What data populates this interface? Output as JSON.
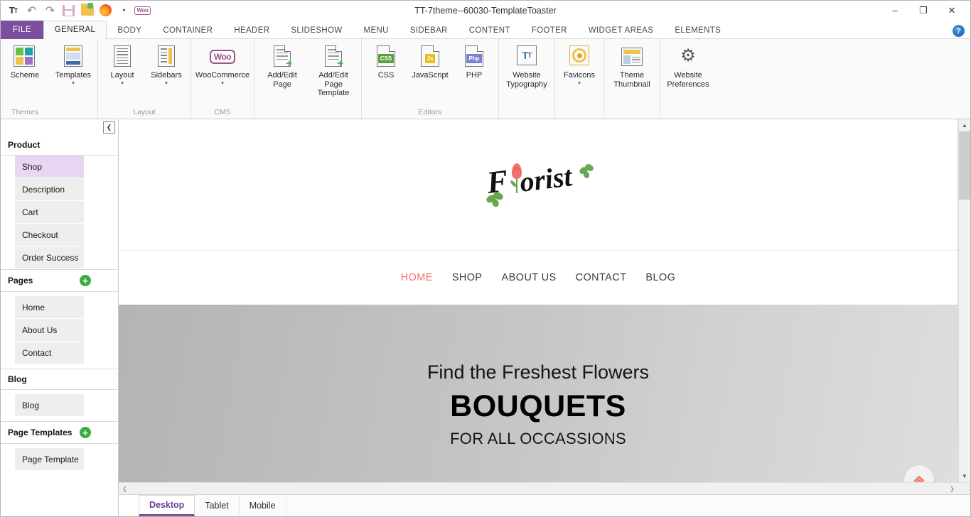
{
  "window": {
    "title": "TT-7theme--60030-TemplateToaster",
    "minimize_label": "—",
    "restore_label": "❐",
    "close_label": "✕",
    "help_label": "?"
  },
  "quick_access": [
    {
      "name": "typography-icon",
      "label": "TT"
    },
    {
      "name": "undo-icon",
      "label": "↶"
    },
    {
      "name": "redo-icon",
      "label": "↷"
    },
    {
      "name": "save-icon",
      "label": "Save"
    },
    {
      "name": "publish-icon",
      "label": "Publish"
    },
    {
      "name": "firefox-preview-icon",
      "label": "Preview"
    },
    {
      "name": "preview-dropdown-icon",
      "label": "▾"
    },
    {
      "name": "woocommerce-icon",
      "label": "Woo"
    }
  ],
  "ribbon": {
    "file_tab": "FILE",
    "tabs": [
      {
        "label": "GENERAL",
        "active": true
      },
      {
        "label": "BODY",
        "active": false
      },
      {
        "label": "CONTAINER",
        "active": false
      },
      {
        "label": "HEADER",
        "active": false
      },
      {
        "label": "SLIDESHOW",
        "active": false
      },
      {
        "label": "MENU",
        "active": false
      },
      {
        "label": "SIDEBAR",
        "active": false
      },
      {
        "label": "CONTENT",
        "active": false
      },
      {
        "label": "FOOTER",
        "active": false
      },
      {
        "label": "WIDGET AREAS",
        "active": false
      },
      {
        "label": "ELEMENTS",
        "active": false
      }
    ],
    "groups": [
      {
        "name": "themes",
        "label": "Themes",
        "buttons": [
          {
            "name": "scheme",
            "label": "Scheme",
            "icon": "scheme-icon",
            "caret": false
          }
        ]
      },
      {
        "name": "themes-templates",
        "label": "",
        "buttons": [
          {
            "name": "templates",
            "label": "Templates",
            "icon": "templates-icon",
            "caret": true
          }
        ]
      },
      {
        "name": "layout",
        "label": "Layout",
        "buttons": [
          {
            "name": "layout",
            "label": "Layout",
            "icon": "layout-icon",
            "caret": true
          },
          {
            "name": "sidebars",
            "label": "Sidebars",
            "icon": "sidebars-icon",
            "caret": true
          }
        ]
      },
      {
        "name": "cms",
        "label": "CMS",
        "buttons": [
          {
            "name": "woocommerce",
            "label": "WooCommerce",
            "icon": "woocommerce-icon",
            "caret": true
          }
        ]
      },
      {
        "name": "pages",
        "label": "",
        "buttons": [
          {
            "name": "add-edit-page",
            "label": "Add/Edit Page",
            "icon": "page-add-icon",
            "caret": false
          },
          {
            "name": "add-edit-page-template",
            "label": "Add/Edit Page Template",
            "icon": "page-template-add-icon",
            "caret": false
          }
        ]
      },
      {
        "name": "editors",
        "label": "Editors",
        "buttons": [
          {
            "name": "css-editor",
            "label": "CSS",
            "icon": "css-file-icon",
            "badge": "CSS",
            "badge_color": "#5a9e3f",
            "caret": false
          },
          {
            "name": "javascript-editor",
            "label": "JavaScript",
            "icon": "js-file-icon",
            "badge": "Js",
            "badge_color": "#e3c01a",
            "caret": false
          },
          {
            "name": "php-editor",
            "label": "PHP",
            "icon": "php-file-icon",
            "badge": "Php",
            "badge_color": "#7b7fd4",
            "caret": false
          }
        ]
      },
      {
        "name": "website-settings",
        "label": "",
        "buttons": [
          {
            "name": "website-typography",
            "label": "Website Typography",
            "icon": "typography-icon",
            "caret": false
          },
          {
            "name": "favicons",
            "label": "Favicons",
            "icon": "favicon-icon",
            "caret": true
          },
          {
            "name": "theme-thumbnail",
            "label": "Theme Thumbnail",
            "icon": "thumbnail-icon",
            "caret": false
          },
          {
            "name": "website-preferences",
            "label": "Website Preferences",
            "icon": "gear-icon",
            "caret": false
          }
        ]
      }
    ]
  },
  "sidebar": {
    "collapse_label": "❮",
    "sections": [
      {
        "name": "product",
        "title": "Product",
        "has_add": false,
        "items": [
          {
            "label": "Shop",
            "active": true
          },
          {
            "label": "Description",
            "active": false
          },
          {
            "label": "Cart",
            "active": false
          },
          {
            "label": "Checkout",
            "active": false
          },
          {
            "label": "Order Success",
            "active": false
          }
        ]
      },
      {
        "name": "pages",
        "title": "Pages",
        "has_add": true,
        "add_label": "+",
        "items": [
          {
            "label": "Home",
            "active": false
          },
          {
            "label": "About Us",
            "active": false
          },
          {
            "label": "Contact",
            "active": false
          }
        ]
      },
      {
        "name": "blog",
        "title": "Blog",
        "has_add": false,
        "items": [
          {
            "label": "Blog",
            "active": false
          }
        ]
      },
      {
        "name": "page-templates",
        "title": "Page Templates",
        "has_add": true,
        "add_label": "+",
        "items": [
          {
            "label": "Page Template",
            "active": false
          }
        ]
      }
    ]
  },
  "preview": {
    "logo_text": "Florist",
    "nav": [
      {
        "label": "HOME",
        "active": true
      },
      {
        "label": "SHOP",
        "active": false
      },
      {
        "label": "ABOUT US",
        "active": false
      },
      {
        "label": "CONTACT",
        "active": false
      },
      {
        "label": "BLOG",
        "active": false
      }
    ],
    "hero": {
      "line1": "Find the Freshest Flowers",
      "line2": "BOUQUETS",
      "line3": "FOR ALL OCCASSIONS"
    },
    "scroll_top_label": "«",
    "scroll_up_arrow": "▲",
    "scroll_down_arrow": "▼",
    "scroll_left_arrow": "❮",
    "scroll_right_arrow": "❯"
  },
  "device_tabs": [
    {
      "label": "Desktop",
      "active": true
    },
    {
      "label": "Tablet",
      "active": false
    },
    {
      "label": "Mobile",
      "active": false
    }
  ],
  "colors": {
    "accent_purple": "#7b4f9d",
    "accent_coral": "#f2736b",
    "add_green": "#3faa42",
    "active_item": "#e8d6f2"
  }
}
